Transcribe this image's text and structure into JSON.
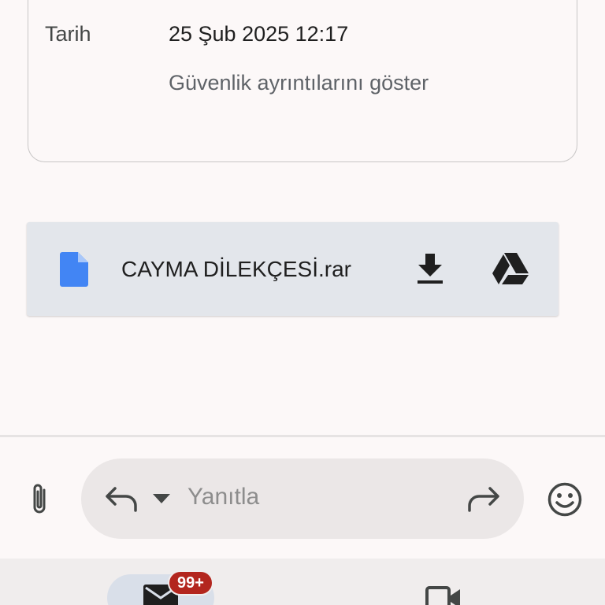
{
  "message_details": {
    "date_label": "Tarih",
    "date_value": "25 Şub 2025 12:17",
    "security_link": "Güvenlik ayrıntılarını göster"
  },
  "attachment": {
    "file_name": "CAYMA DİLEKÇESİ.rar",
    "file_icon": "document-icon",
    "actions": [
      "download-icon",
      "google-drive-icon"
    ]
  },
  "reply_bar": {
    "placeholder": "Yanıtla",
    "icons": [
      "attach-icon",
      "reply-icon",
      "chevron-down-icon",
      "forward-icon",
      "emoji-icon"
    ]
  },
  "bottom_nav": {
    "items": [
      {
        "name": "mail",
        "icon": "mail-icon",
        "badge": "99+"
      },
      {
        "name": "meet",
        "icon": "video-camera-icon"
      }
    ]
  },
  "colors": {
    "background": "#fcf8f8",
    "attachment_bg": "#e3e6eb",
    "file_icon_blue": "#4285f4",
    "badge_red": "#b3261e",
    "reply_pill": "#ebe7e7",
    "mail_pill": "#d9dfe9"
  }
}
